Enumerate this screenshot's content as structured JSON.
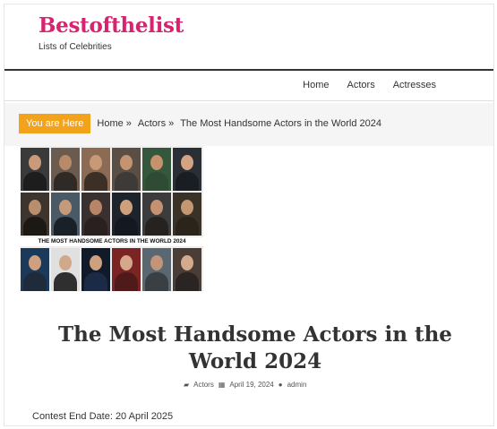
{
  "site": {
    "title": "Bestofthelist",
    "tagline": "Lists of Celebrities"
  },
  "nav": {
    "items": [
      {
        "label": "Home"
      },
      {
        "label": "Actors"
      },
      {
        "label": "Actresses"
      }
    ]
  },
  "breadcrumb": {
    "prefix": "You are Here",
    "items": [
      {
        "label": "Home"
      },
      {
        "label": "Actors"
      },
      {
        "label": "The Most Handsome Actors in the World 2024"
      }
    ],
    "separator": "»"
  },
  "featured_image": {
    "caption": "THE MOST HANDSOME ACTORS IN THE WORLD 2024"
  },
  "post": {
    "title": "The Most Handsome Actors in the World 2024",
    "category": "Actors",
    "date": "April 19, 2024",
    "author": "admin"
  },
  "contest": {
    "text": "Contest End Date: 20 April 2025"
  },
  "colors": {
    "brand": "#d6246e",
    "accent": "#f2a31b",
    "text": "#333333"
  },
  "icons": {
    "category": "folder-icon",
    "date": "calendar-icon",
    "author": "user-icon"
  }
}
